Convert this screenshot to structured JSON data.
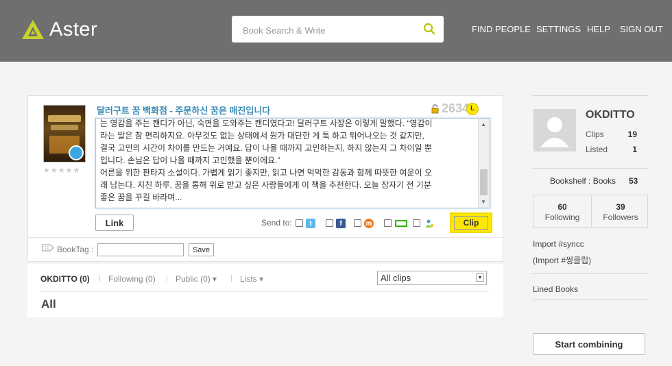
{
  "header": {
    "logo_text": "Aster",
    "search_placeholder": "Book Search & Write",
    "nav": [
      "FIND PEOPLE",
      "SETTINGS",
      "HELP",
      "SIGN OUT"
    ]
  },
  "clip_card": {
    "book_title": "달러구트 꿈 백화점 - 주문하신 꿈은 매진입니다",
    "count": "2634",
    "level_badge": "L",
    "text_lines": [
      "는 영감을 주는 캔디가 아닌, 숙면을 도와주는 캔디였다고! 달러구트 사장은 이렇게 말했다. “영감이",
      "라는 말은 참 편리하지요. 아무것도 없는 상태에서 뭔가 대단한 게 툭 하고 튀어나오는 것 같지만,",
      "결국 고민의 시간이 차이를 만드는 거예요. 답이 나올 때까지 고민하는지, 하지 않는지 그 차이일 뿐",
      "입니다. 손님은 답이 나올 때까지 고민했을 뿐이에요.”",
      "어른을 위한 판타지 소설이다. 가볍게 읽기 좋지만, 읽고 나면 먹먹한 감동과 함께 따뜻한 여운이 오",
      "래 남는다. 지친 하루, 꿈을 통해 위로 받고 싶은 사람들에게 이 책을 추천한다. 오늘 잠자기 전 기분",
      "좋은 꿈을 꾸길 바라며..."
    ],
    "link_label": "Link",
    "send_to_label": "Send to:",
    "clip_label": "Clip",
    "booktag_label": "BookTag :",
    "save_label": "Save",
    "stars": "★★★★★",
    "colors": {
      "accent": "#ffe800",
      "title": "#3a8ab5"
    }
  },
  "tabs": {
    "items": [
      {
        "label": "OKDITTO (0)",
        "active": true
      },
      {
        "label": "Following (0)",
        "active": false
      },
      {
        "label": "Public (0) ▾",
        "active": false
      },
      {
        "label": "Lists ▾",
        "active": false
      }
    ],
    "filter_selected": "All clips",
    "heading": "All"
  },
  "profile": {
    "username": "OKDITTO",
    "clips_label": "Clips",
    "clips_value": "19",
    "listed_label": "Listed",
    "listed_value": "1",
    "bookshelf_label": "Bookshelf : Books",
    "bookshelf_value": "53",
    "following_value": "60",
    "following_label": "Following",
    "followers_value": "39",
    "followers_label": "Followers",
    "import_1": "Import #syncc",
    "import_2": "(Import #씽클립)",
    "lined_books": "Lined Books",
    "start_combining": "Start combining"
  }
}
